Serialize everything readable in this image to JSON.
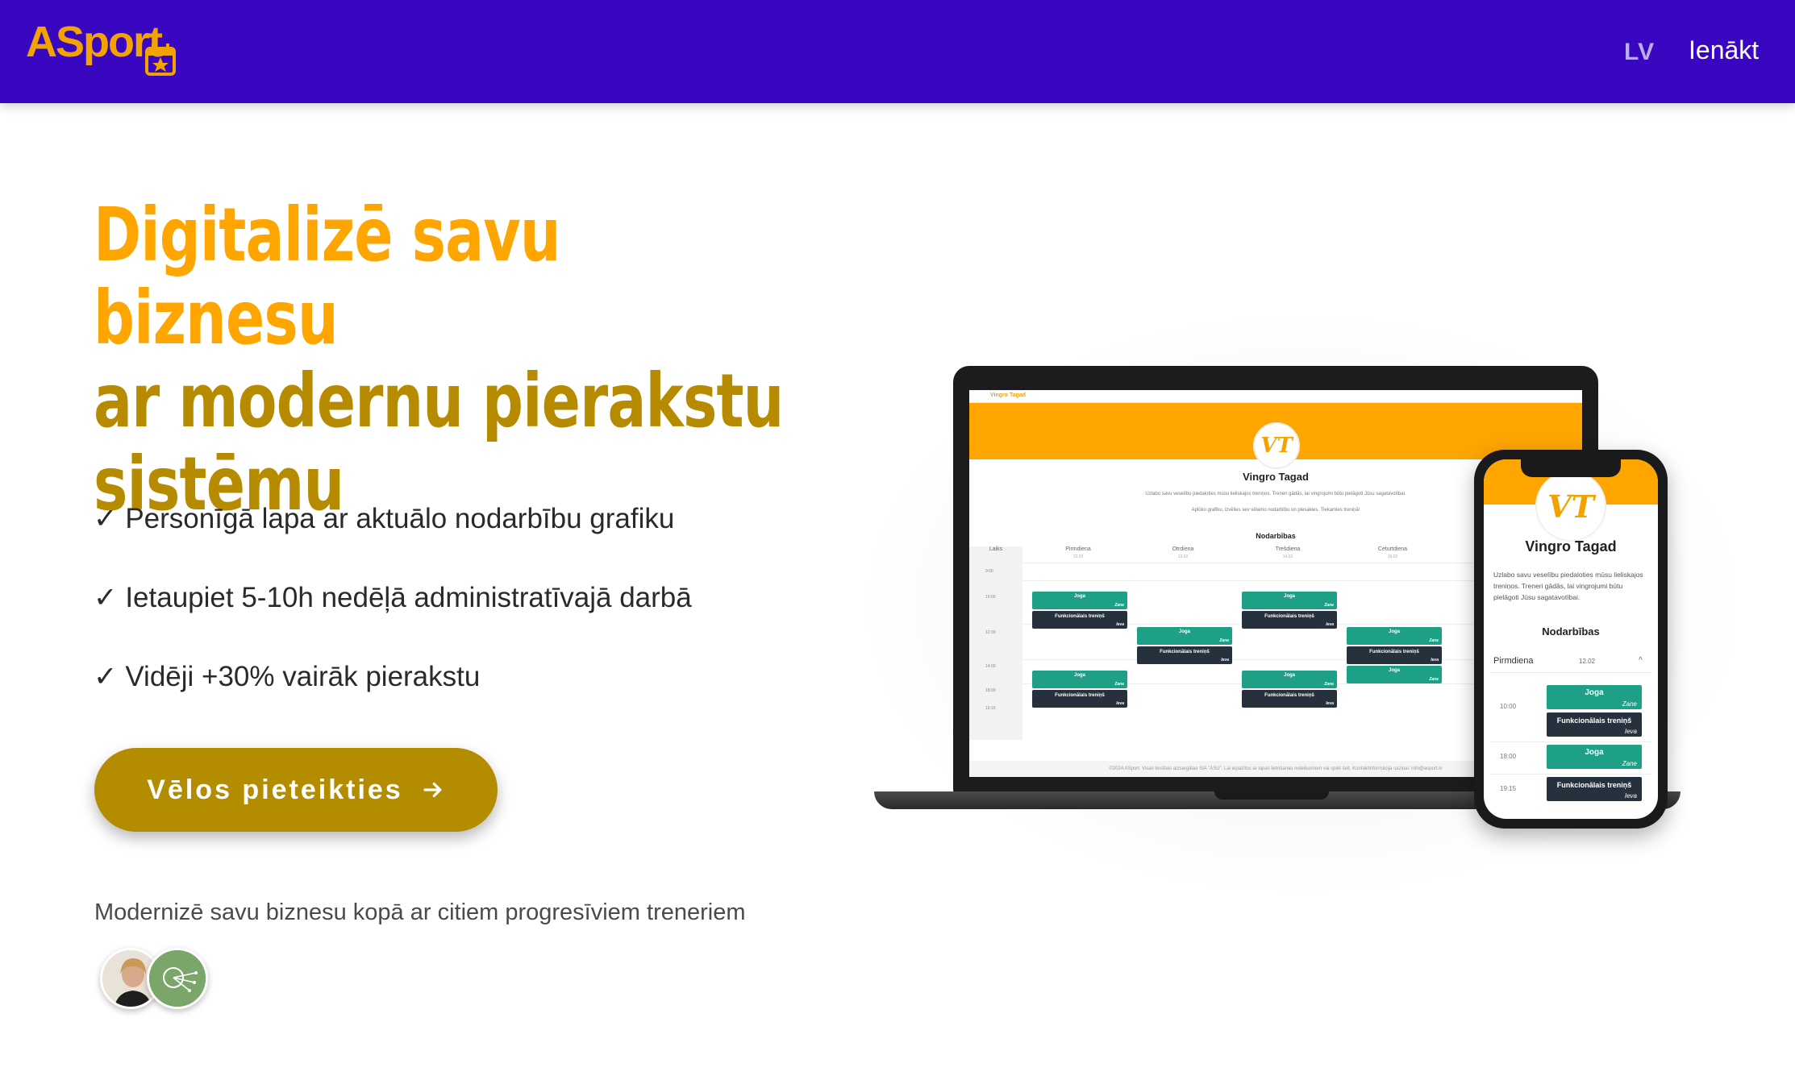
{
  "nav": {
    "logo_text": "ASport",
    "language": "LV",
    "login": "Ienākt"
  },
  "hero": {
    "headline_line1": "Digitalizē savu biznesu",
    "headline_line2": "ar modernu pierakstu",
    "headline_line3": "sistēmu",
    "features": [
      {
        "check": "✓",
        "text": "Personīgā lapa ar aktuālo nodarbību grafiku"
      },
      {
        "check": "✓",
        "text": "Ietaupiet 5-10h nedēļā administratīvajā darbā"
      },
      {
        "check": "✓",
        "text": "Vidēji +30% vairāk pierakstu"
      }
    ],
    "cta_label": "Vēlos pieteikties",
    "social_proof": "Modernizē savu biznesu kopā ar citiem progresīviem treneriem"
  },
  "mockup": {
    "laptop": {
      "top_label": "Vingro Tagad",
      "logo": "VT",
      "name": "Vingro Tagad",
      "description": "Uzlabo savu veselību piedaloties mūsu lieliskajos treniņos. Treneri gādās, lai vingrojumi būtu pielāgoti Jūsu sagatavotībai.",
      "description2": "Aplūko grafiku, izvēlies sev vēlamo nodarbību un piesakies. Tiekamies treniņā!",
      "section": "Nodarbības",
      "time_header": "Laiks",
      "days": [
        {
          "name": "Pirmdiena",
          "date": "12.02"
        },
        {
          "name": "Otrdiena",
          "date": "13.02"
        },
        {
          "name": "Trešdiena",
          "date": "14.02"
        },
        {
          "name": "Ceturtdiena",
          "date": "15.02"
        }
      ],
      "times": [
        "9:00",
        "10:00",
        "12:00",
        "14:00",
        "18:00",
        "19:15"
      ],
      "slot_yoga": "Joga",
      "slot_yoga_trainer": "Zane",
      "slot_func": "Funkcionālais treniņš",
      "slot_func_trainer": "Ieva",
      "footer": "©2024 ASport. Visas tiesības aizsargātas SIA \"ASU\". Lai iepazītos ar lapas lietošanas noteikumiem vai spiet šeit. Kontaktinformācija saziņai: info@asport.lv"
    },
    "phone": {
      "logo": "VT",
      "name": "Vingro Tagad",
      "description": "Uzlabo savu veselību piedaloties mūsu lieliskajos treniņos. Treneri gādās, lai vingrojumi būtu pielāgoti Jūsu sagatavotībai.",
      "section": "Nodarbības",
      "day": "Pirmdiena",
      "date": "12.02",
      "chevron": "^",
      "slots": [
        {
          "time": "10:00",
          "yoga": "Joga",
          "yoga_trainer": "Zane",
          "func": "Funkcionālais treniņš",
          "func_trainer": "Ieva"
        },
        {
          "time": "18:00",
          "yoga": "Joga",
          "yoga_trainer": "Zane"
        },
        {
          "time": "19:15",
          "func": "Funkcionālais treniņš",
          "func_trainer": "Ieva"
        }
      ]
    }
  },
  "colors": {
    "nav_bg": "#3a07c0",
    "accent_orange": "#fea500",
    "accent_gold": "#b68b00",
    "cta_bg": "#b48c00",
    "slot_green": "#1ea087",
    "slot_dark": "#26313d"
  },
  "icons": {
    "logo_calendar": "calendar-star-icon",
    "cta_arrow": "arrow-right-icon"
  }
}
